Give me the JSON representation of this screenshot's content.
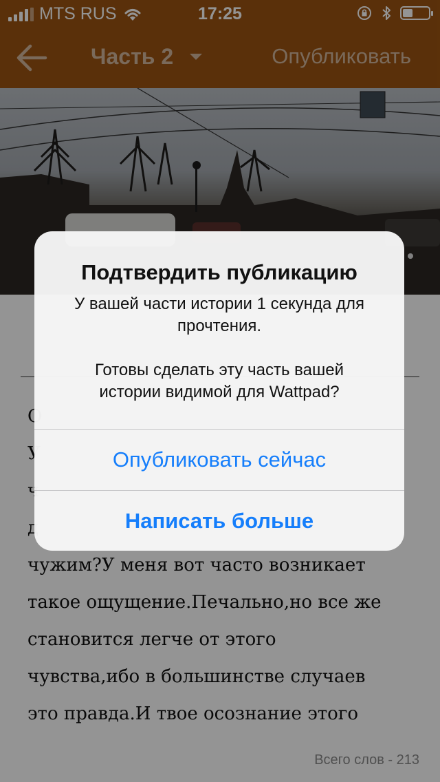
{
  "status_bar": {
    "carrier": "MTS RUS",
    "time": "17:25"
  },
  "nav": {
    "title": "Часть 2",
    "publish_label": "Опубликовать"
  },
  "editor": {
    "body_lines": [
      "О",
      "У",
      "ч",
      "д",
      "чужим?У меня вот часто возникает",
      "такое ощущение.Печально,но все же",
      "становится легче от этого",
      "чувства,ибо в большинстве случаев",
      "это правда.И твое осознание этого"
    ],
    "word_count": "Всего слов - 213"
  },
  "alert": {
    "title": "Подтвердить публикацию",
    "message_line1": "У вашей части истории 1 секунда для прочтения.",
    "message_line2": "Готовы сделать эту часть вашей истории видимой для Wattpad?",
    "publish_now": "Опубликовать сейчас",
    "write_more": "Написать больше"
  },
  "colors": {
    "header": "#9c5412",
    "alert_button": "#157efb"
  },
  "icons": [
    "back-arrow-icon",
    "chevron-down-icon",
    "wifi-icon",
    "orientation-lock-icon",
    "bluetooth-icon",
    "battery-icon",
    "signal-icon"
  ]
}
